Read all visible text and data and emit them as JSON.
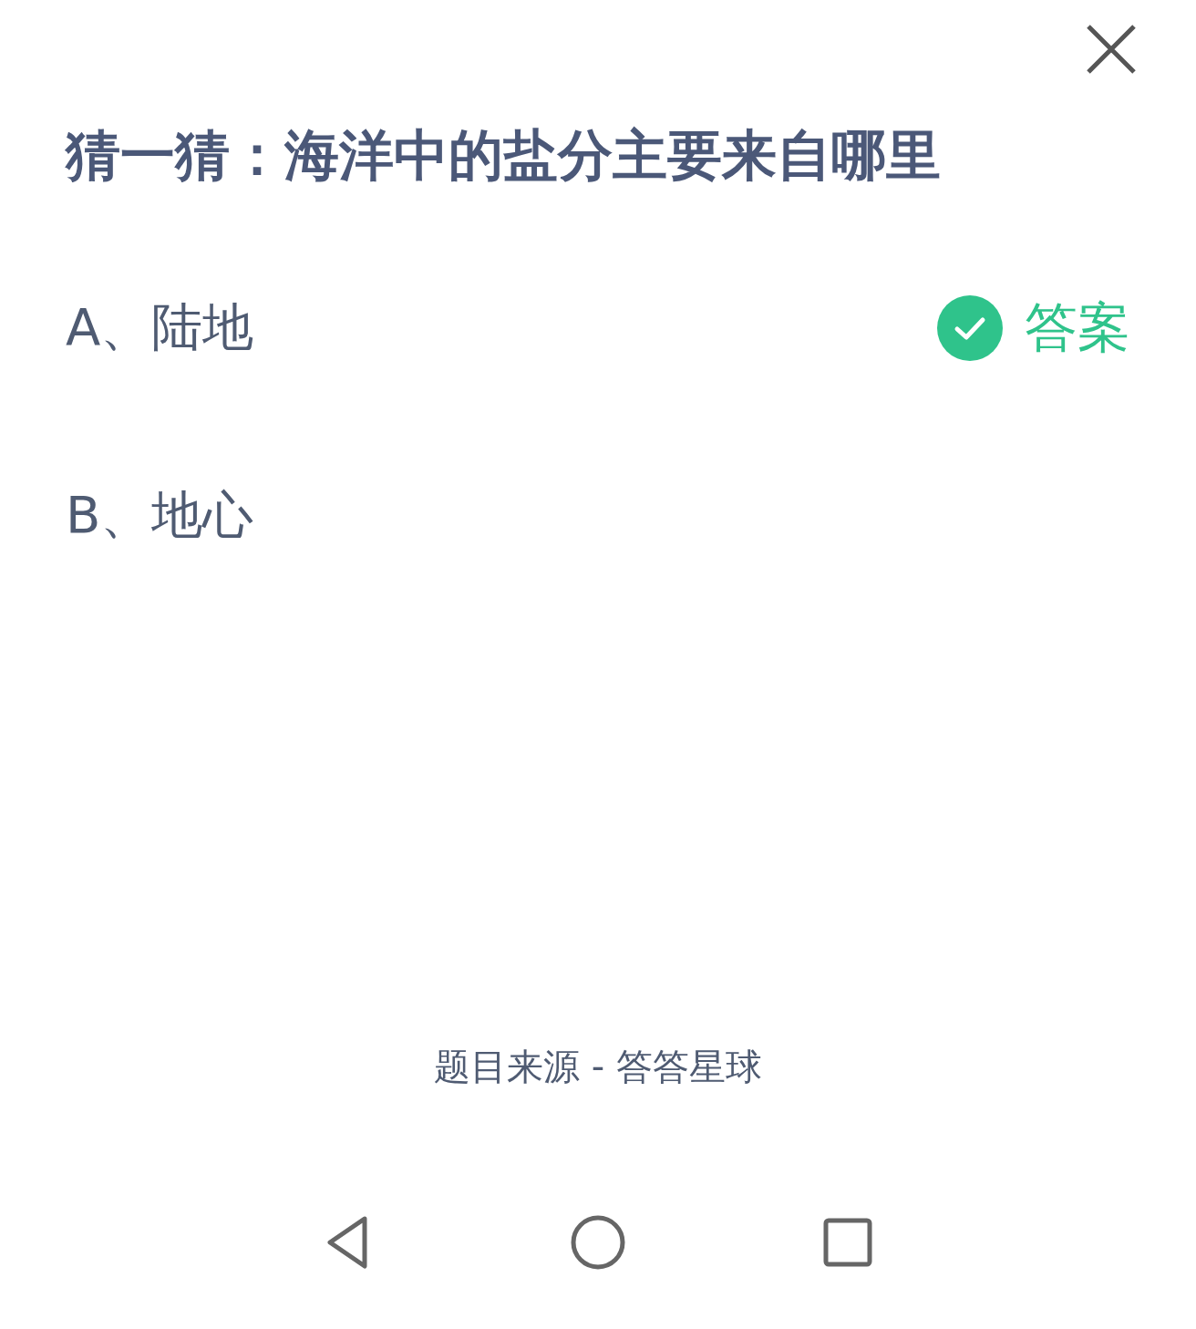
{
  "title": "猜一猜：海洋中的盐分主要来自哪里",
  "options": [
    {
      "label": "A、陆地",
      "correct": true,
      "badge": "答案"
    },
    {
      "label": "B、地心",
      "correct": false
    }
  ],
  "source": "题目来源 - 答答星球"
}
